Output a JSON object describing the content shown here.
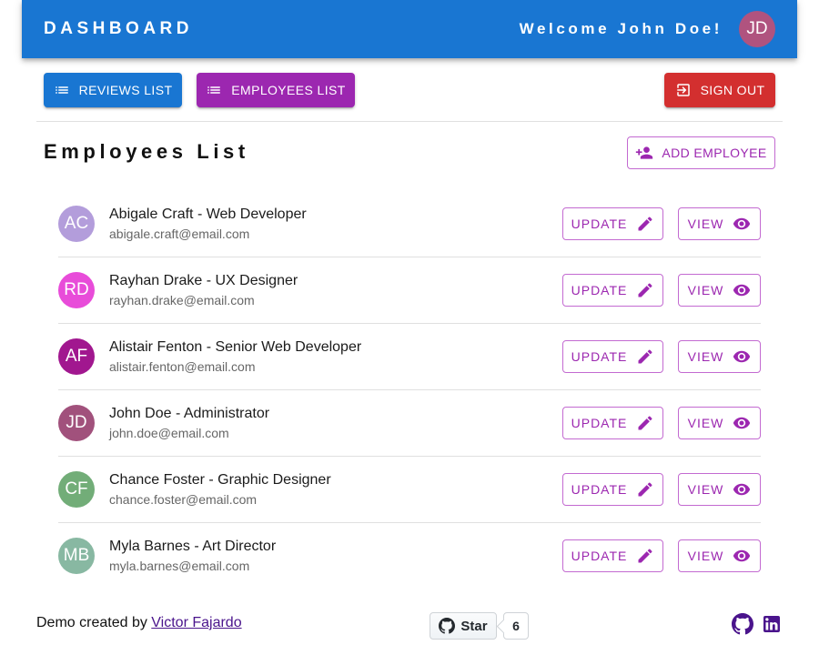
{
  "header": {
    "brand": "DASHBOARD",
    "welcome": "Welcome John Doe!",
    "avatar_initials": "JD",
    "avatar_color": "#b0537f",
    "bar_color": "#1976d2"
  },
  "nav": {
    "reviews_label": "REVIEWS LIST",
    "employees_label": "EMPLOYEES LIST",
    "signout_label": "SIGN OUT"
  },
  "section": {
    "title": "Employees List",
    "add_label": "ADD EMPLOYEE"
  },
  "employees": [
    {
      "initials": "AC",
      "name": "Abigale Craft - Web Developer",
      "email": "abigale.craft@email.com",
      "color": "#b39ddb",
      "update_label": "UPDATE",
      "view_label": "VIEW"
    },
    {
      "initials": "RD",
      "name": "Rayhan Drake - UX Designer",
      "email": "rayhan.drake@email.com",
      "color": "#e84cd9",
      "update_label": "UPDATE",
      "view_label": "VIEW"
    },
    {
      "initials": "AF",
      "name": "Alistair Fenton - Senior Web Developer",
      "email": "alistair.fenton@email.com",
      "color": "#a1178f",
      "update_label": "UPDATE",
      "view_label": "VIEW"
    },
    {
      "initials": "JD",
      "name": "John Doe - Administrator",
      "email": "john.doe@email.com",
      "color": "#a1517c",
      "update_label": "UPDATE",
      "view_label": "VIEW"
    },
    {
      "initials": "CF",
      "name": "Chance Foster - Graphic Designer",
      "email": "chance.foster@email.com",
      "color": "#72ad78",
      "update_label": "UPDATE",
      "view_label": "VIEW"
    },
    {
      "initials": "MB",
      "name": "Myla Barnes - Art Director",
      "email": "myla.barnes@email.com",
      "color": "#88b8a2",
      "update_label": "UPDATE",
      "view_label": "VIEW"
    }
  ],
  "footer": {
    "credit_prefix": "Demo created by ",
    "credit_link": "Victor Fajardo",
    "star_label": "Star",
    "star_count": "6"
  },
  "icons": {
    "list": "list-icon",
    "signout": "logout-icon",
    "add_person": "person-add-icon",
    "edit": "pencil-icon",
    "view": "eye-icon",
    "github": "github-icon",
    "linkedin": "linkedin-icon"
  }
}
